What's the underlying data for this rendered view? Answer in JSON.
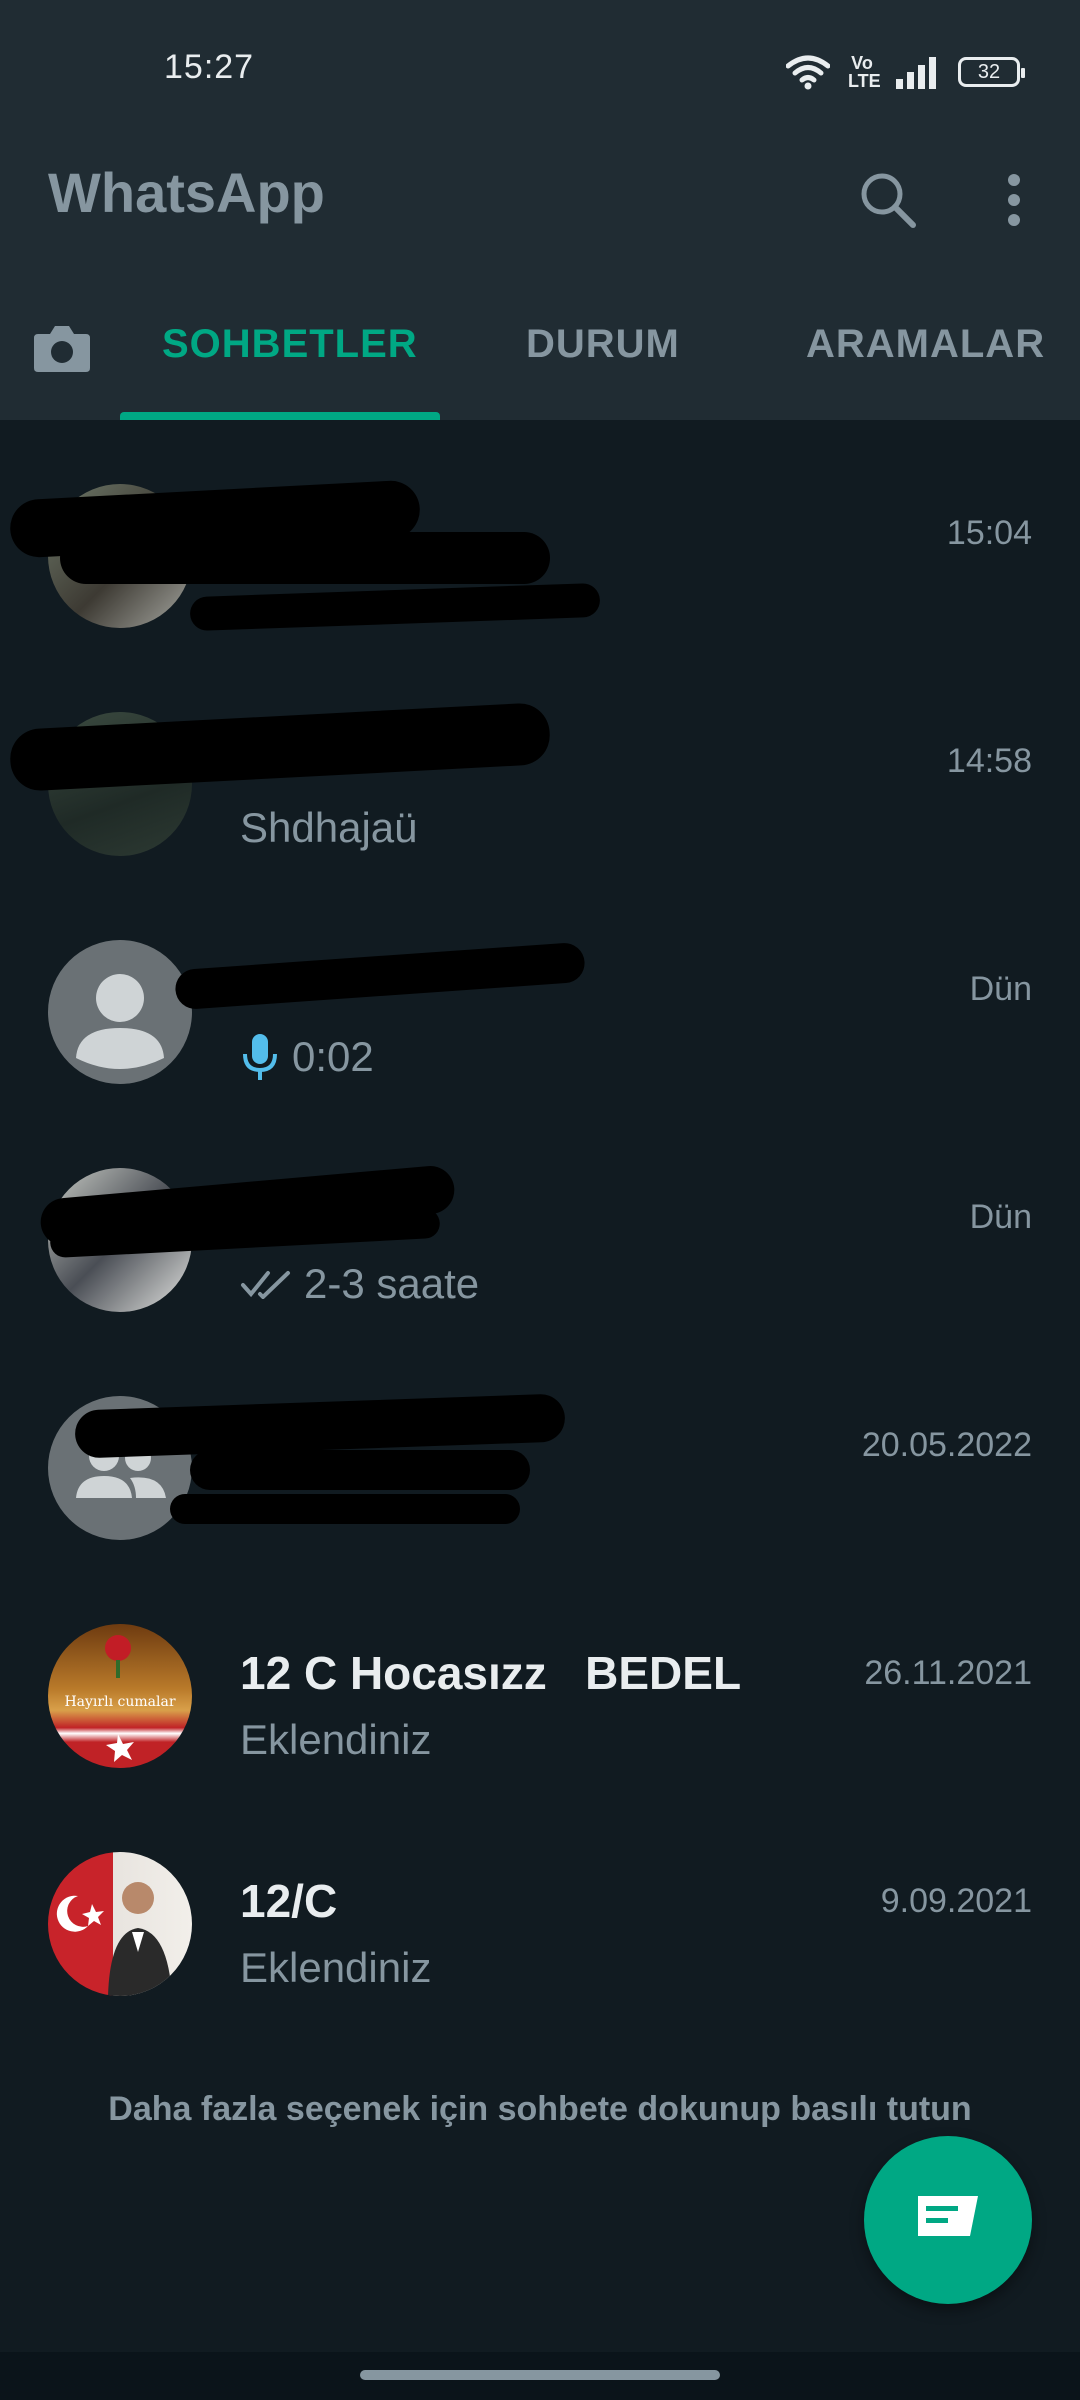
{
  "status_bar": {
    "time": "15:27",
    "network": "Vo LTE",
    "battery": "32"
  },
  "header": {
    "title": "WhatsApp",
    "search_icon": "search-icon",
    "menu_icon": "more-vert-icon"
  },
  "tabs": [
    {
      "label": "SOHBETLER",
      "active": true
    },
    {
      "label": "DURUM",
      "active": false
    },
    {
      "label": "ARAMALAR",
      "active": false
    }
  ],
  "chats": [
    {
      "name": "",
      "preview": "",
      "time": "15:04"
    },
    {
      "name": "",
      "preview": "Shdhajaü",
      "time": "14:58"
    },
    {
      "name": "",
      "preview": "0:02",
      "time": "Dün",
      "icon": "microphone-icon"
    },
    {
      "name": "",
      "preview": "2-3 saate",
      "time": "Dün",
      "icon": "double-check-icon"
    },
    {
      "name": "",
      "preview": "",
      "time": "20.05.2022"
    },
    {
      "name": "12 C Hocasızz   BEDEL",
      "preview": "Eklendiniz",
      "time": "26.11.2021",
      "avatar_text": "Hayırlı cumalar"
    },
    {
      "name": "12/C",
      "preview": "Eklendiniz",
      "time": "9.09.2021"
    }
  ],
  "hint": "Daha fazla seçenek için sohbete dokunup basılı tutun",
  "fab": {
    "icon": "new-chat-icon"
  },
  "colors": {
    "accent": "#00a884",
    "background": "#111b21",
    "header": "#202c33",
    "secondary_text": "#8696a0",
    "mic": "#53bdeb"
  }
}
